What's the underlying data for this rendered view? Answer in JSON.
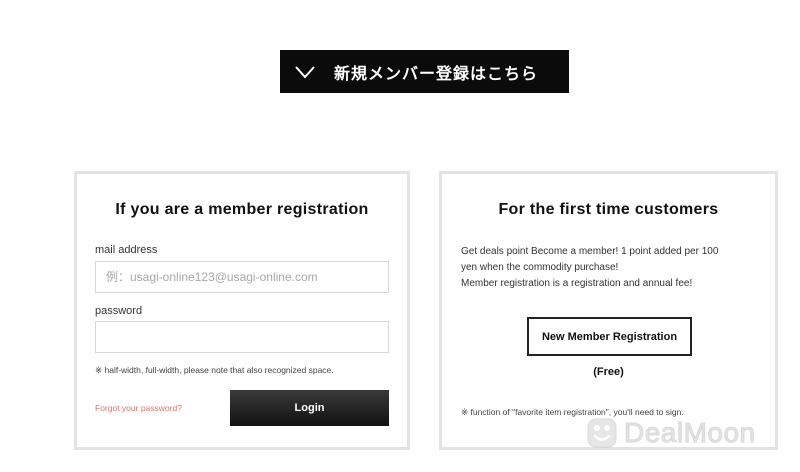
{
  "banner": {
    "label": "新規メンバー登録はこちら",
    "icon": "chevron-down-icon"
  },
  "login_panel": {
    "title": "If you are a member registration",
    "mail_label": "mail address",
    "mail_placeholder": "例：usagi-online123@usagi-online.com",
    "mail_value": "",
    "password_label": "password",
    "password_value": "",
    "space_note": "※ half-width, full-width, please note that also recognized space.",
    "forgot_link": "Forgot your password?",
    "login_button": "Login"
  },
  "new_customer_panel": {
    "title": "For the first time customers",
    "description_lines": [
      "Get deals point Become a member! 1 point added per 100",
      "yen when the commodity purchase!",
      "Member registration is a registration and annual fee!"
    ],
    "register_button": "New Member Registration",
    "free_label": "(Free)",
    "sign_note": "※ function of \"favorite item registration\", you'll need to sign."
  },
  "watermark": {
    "text": "DealMoon"
  }
}
